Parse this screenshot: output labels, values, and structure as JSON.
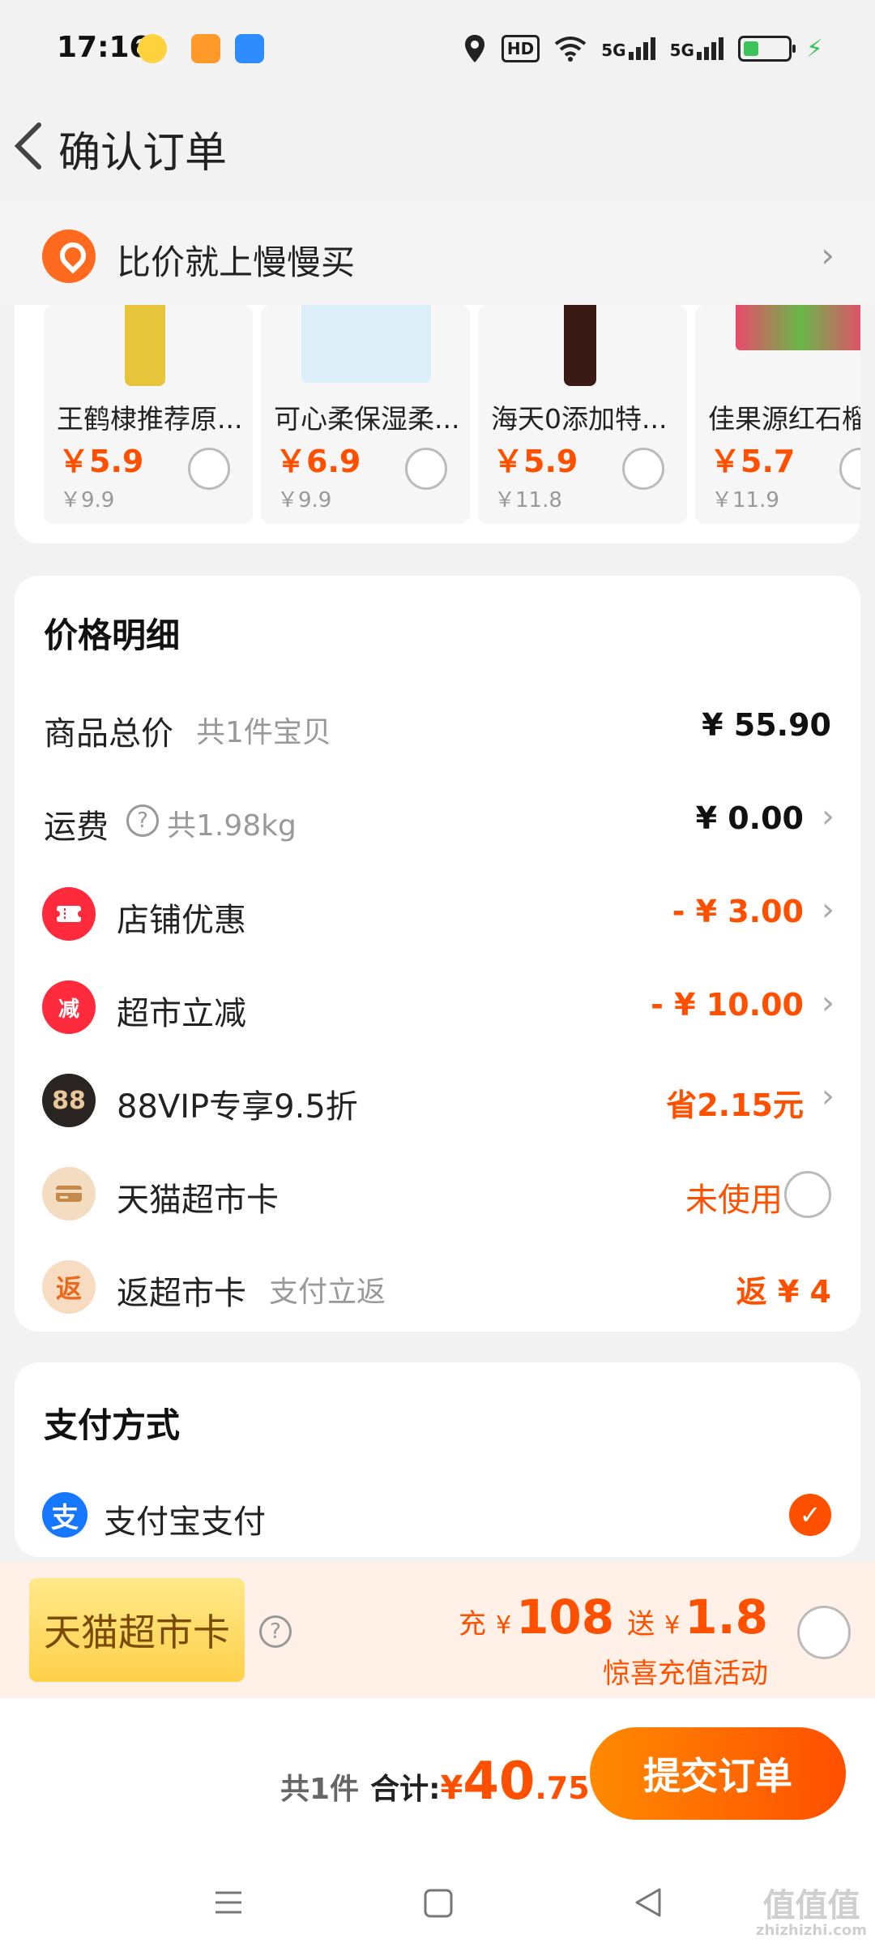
{
  "status_bar": {
    "time": "17:16",
    "hd_label": "HD",
    "network": [
      "5G",
      "5G"
    ]
  },
  "header": {
    "title": "确认订单"
  },
  "banner": {
    "text": "比价就上慢慢买"
  },
  "products": [
    {
      "name": "王鹤棣推荐原...",
      "price": "￥5.9",
      "old_price": "￥9.9"
    },
    {
      "name": "可心柔保湿柔...",
      "price": "￥6.9",
      "old_price": "￥9.9"
    },
    {
      "name": "海天0添加特...",
      "price": "￥5.9",
      "old_price": "￥11.8"
    },
    {
      "name": "佳果源红石榴",
      "price": "￥5.7",
      "old_price": "￥11.9"
    }
  ],
  "price_detail": {
    "title": "价格明细",
    "rows": {
      "goods_total": {
        "label": "商品总价",
        "sub": "共1件宝贝",
        "value": "¥ 55.90"
      },
      "shipping": {
        "label": "运费",
        "sub": "共1.98kg",
        "value": "¥ 0.00"
      },
      "store_discount": {
        "label": "店铺优惠",
        "value": "- ¥ 3.00",
        "icon_text": ""
      },
      "market_cut": {
        "label": "超市立减",
        "value": "- ¥ 10.00",
        "icon_text": "减"
      },
      "vip": {
        "label": "88VIP专享9.5折",
        "value": "省2.15元",
        "icon_text": "88"
      },
      "market_card": {
        "label": "天猫超市卡",
        "value": "未使用"
      },
      "cashback": {
        "label": "返超市卡",
        "sub": "支付立返",
        "value": "返 ¥ 4",
        "icon_text": "返"
      }
    }
  },
  "payment": {
    "title": "支付方式",
    "method": "支付宝支付",
    "icon_text": "支"
  },
  "promo": {
    "badge": "天猫超市卡",
    "charge_prefix": "充",
    "charge_currency": "¥",
    "charge_amount": "108",
    "gift_prefix": "送",
    "gift_currency": "¥",
    "gift_amount": "1.8",
    "caption": "惊喜充值活动"
  },
  "footer": {
    "count": "共1件",
    "total_label": "合计:",
    "currency": "¥",
    "total_int": "40",
    "total_dec": ".75",
    "submit": "提交订单"
  },
  "watermark": {
    "main": "值值值",
    "sub": "zhizhizhi.com"
  },
  "colors": {
    "accent": "#ff5000",
    "alipay": "#1677ff",
    "background": "#f2f2f2"
  }
}
